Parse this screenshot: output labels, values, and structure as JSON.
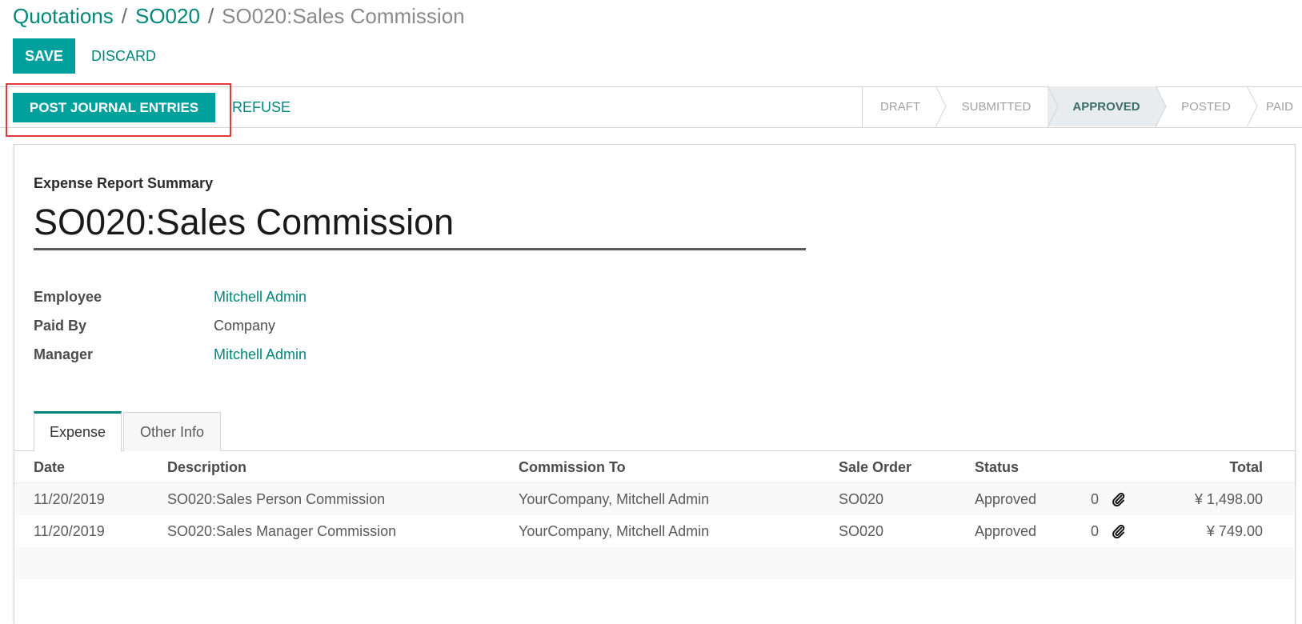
{
  "breadcrumb": {
    "items": [
      "Quotations",
      "SO020"
    ],
    "current": "SO020:Sales Commission",
    "separator": "/"
  },
  "actions": {
    "save_label": "SAVE",
    "discard_label": "DISCARD"
  },
  "statusbar": {
    "post_label": "POST JOURNAL ENTRIES",
    "refuse_label": "REFUSE",
    "stages": [
      "DRAFT",
      "SUBMITTED",
      "APPROVED",
      "POSTED",
      "PAID"
    ],
    "active_stage": "APPROVED"
  },
  "form": {
    "summary_label": "Expense Report Summary",
    "title": "SO020:Sales Commission",
    "fields": [
      {
        "label": "Employee",
        "value": "Mitchell Admin"
      },
      {
        "label": "Paid By",
        "value": "Company"
      },
      {
        "label": "Manager",
        "value": "Mitchell Admin"
      }
    ]
  },
  "tabs": [
    "Expense",
    "Other Info"
  ],
  "table": {
    "headers": {
      "date": "Date",
      "description": "Description",
      "commission_to": "Commission To",
      "sale_order": "Sale Order",
      "status": "Status",
      "total": "Total"
    },
    "rows": [
      {
        "date": "11/20/2019",
        "description": "SO020:Sales Person Commission",
        "commission_to": "YourCompany, Mitchell Admin",
        "sale_order": "SO020",
        "status": "Approved",
        "attachments": "0",
        "total": "¥ 1,498.00"
      },
      {
        "date": "11/20/2019",
        "description": "SO020:Sales Manager Commission",
        "commission_to": "YourCompany, Mitchell Admin",
        "sale_order": "SO020",
        "status": "Approved",
        "attachments": "0",
        "total": "¥ 749.00"
      }
    ]
  },
  "colors": {
    "primary": "#00a09d",
    "link": "#00877a",
    "highlight": "#e33b3b"
  }
}
